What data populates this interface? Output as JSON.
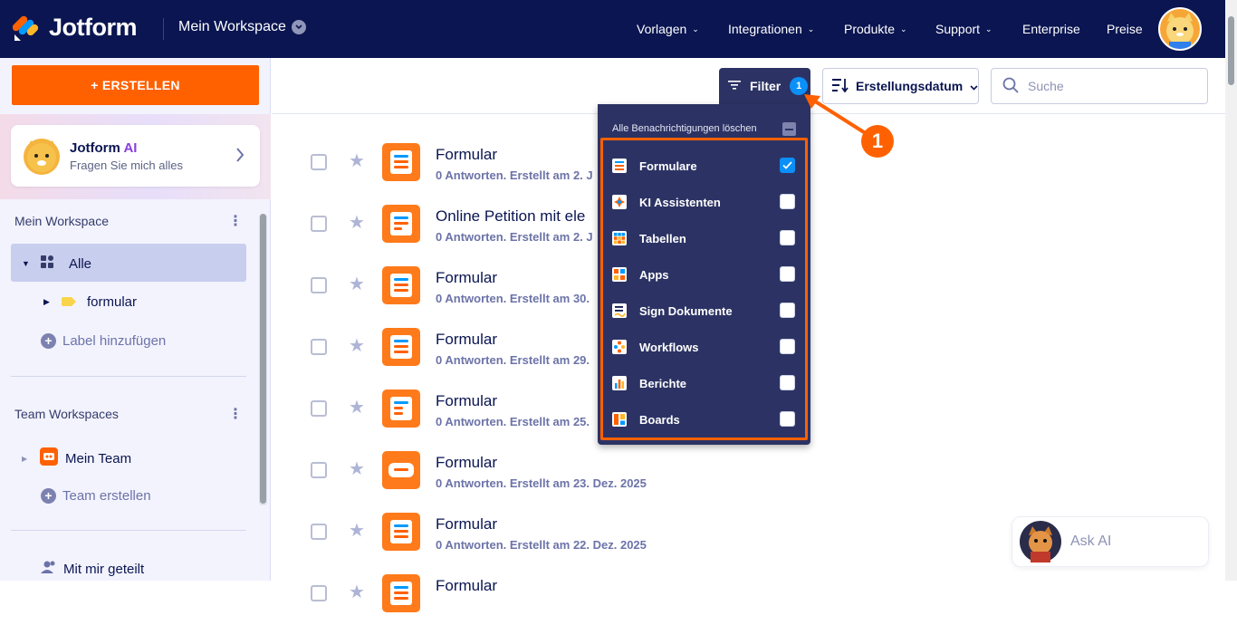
{
  "topbar": {
    "logo": "Jotform",
    "workspace": "Mein Workspace",
    "nav": [
      "Vorlagen",
      "Integrationen",
      "Produkte",
      "Support",
      "Enterprise",
      "Preise"
    ],
    "colors": {
      "bg": "#0a1551",
      "accent": "#ff6100"
    }
  },
  "sidebar": {
    "create_label": "+ ERSTELLEN",
    "ai_title_main": "Jotform",
    "ai_title_accent": "AI",
    "ai_sub": "Fragen Sie mich alles",
    "my_workspace": "Mein Workspace",
    "all": "Alle",
    "folder": "formular",
    "add_label": "Label hinzufügen",
    "team_workspaces": "Team Workspaces",
    "team": "Mein Team",
    "create_team": "Team erstellen",
    "shared": "Mit mir geteilt"
  },
  "toolbar": {
    "filter_label": "Filter",
    "filter_count": "1",
    "sort_label": "Erstellungsdatum",
    "search_placeholder": "Suche"
  },
  "forms": [
    {
      "title": "Formular",
      "meta": "0 Antworten. Erstellt am 2. J"
    },
    {
      "title": "Online Petition mit ele",
      "meta": "0 Antworten. Erstellt am 2. J"
    },
    {
      "title": "Formular",
      "meta": "0 Antworten. Erstellt am 30."
    },
    {
      "title": "Formular",
      "meta": "0 Antworten. Erstellt am 29."
    },
    {
      "title": "Formular",
      "meta": "0 Antworten. Erstellt am 25."
    },
    {
      "title": "Formular",
      "meta": "0 Antworten. Erstellt am 23. Dez. 2025"
    },
    {
      "title": "Formular",
      "meta": "0 Antworten. Erstellt am 22. Dez. 2025"
    },
    {
      "title": "Formular",
      "meta": ""
    }
  ],
  "filter_menu": {
    "clear_label": "Alle Benachrichtigungen löschen",
    "items": [
      {
        "label": "Formulare",
        "checked": true,
        "icon": "forms-icon"
      },
      {
        "label": "KI Assistenten",
        "checked": false,
        "icon": "ai-agent-icon"
      },
      {
        "label": "Tabellen",
        "checked": false,
        "icon": "tables-icon"
      },
      {
        "label": "Apps",
        "checked": false,
        "icon": "apps-icon"
      },
      {
        "label": "Sign Dokumente",
        "checked": false,
        "icon": "sign-icon"
      },
      {
        "label": "Workflows",
        "checked": false,
        "icon": "workflows-icon"
      },
      {
        "label": "Berichte",
        "checked": false,
        "icon": "reports-icon"
      },
      {
        "label": "Boards",
        "checked": false,
        "icon": "boards-icon"
      }
    ]
  },
  "annotation": {
    "number": "1"
  },
  "ask_ai": {
    "label": "Ask AI"
  }
}
